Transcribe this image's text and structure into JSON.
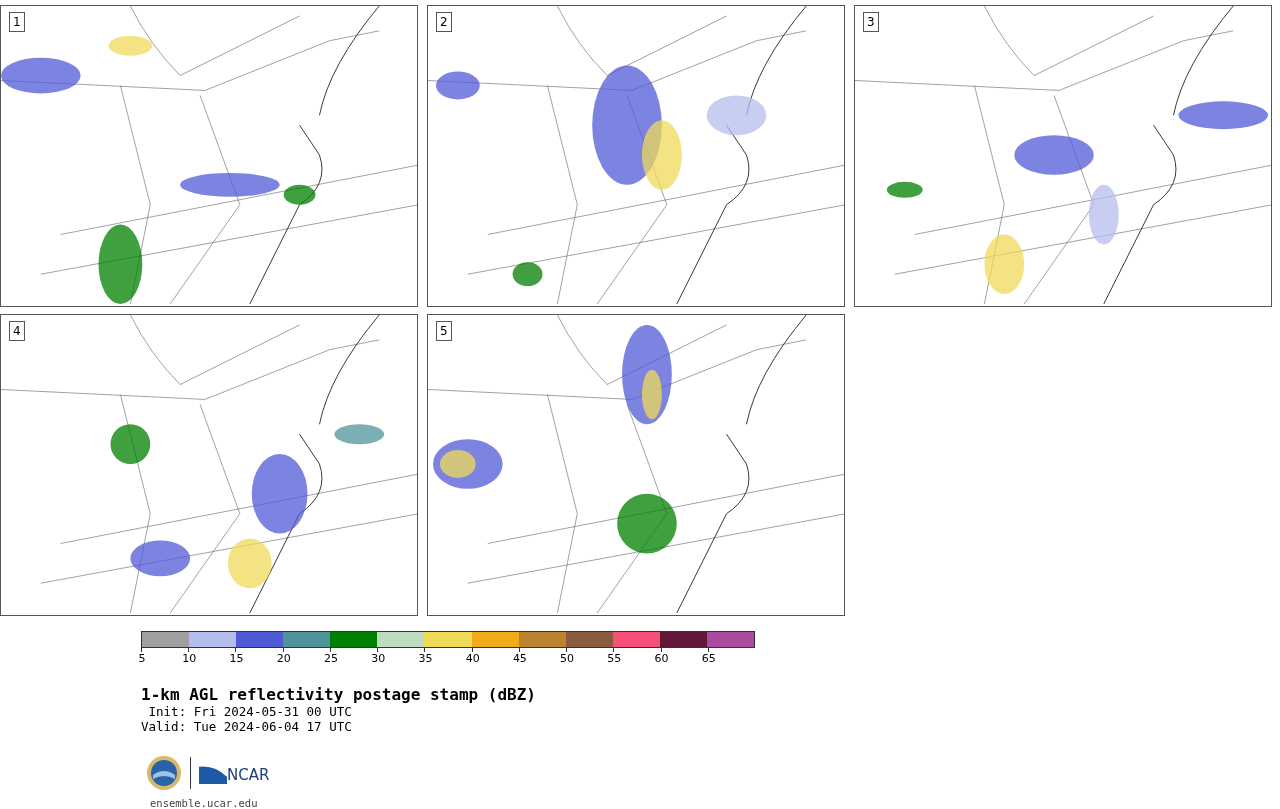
{
  "panels": [
    {
      "label": "1"
    },
    {
      "label": "2"
    },
    {
      "label": "3"
    },
    {
      "label": "4"
    },
    {
      "label": "5"
    }
  ],
  "colorbar": {
    "segments": [
      {
        "color": "#a0a0a0"
      },
      {
        "color": "#b4bdec"
      },
      {
        "color": "#5059d6"
      },
      {
        "color": "#4f949a"
      },
      {
        "color": "#008000"
      },
      {
        "color": "#bddcbd"
      },
      {
        "color": "#efda5a"
      },
      {
        "color": "#efac18"
      },
      {
        "color": "#bb8230"
      },
      {
        "color": "#8a5c3e"
      },
      {
        "color": "#f6507a"
      },
      {
        "color": "#641837"
      },
      {
        "color": "#ab4aa0"
      }
    ],
    "ticks": [
      "5",
      "10",
      "15",
      "20",
      "25",
      "30",
      "35",
      "40",
      "45",
      "50",
      "55",
      "60",
      "65"
    ]
  },
  "title": "1-km AGL reflectivity postage stamp (dBZ)",
  "init": " Init: Fri 2024-05-31 00 UTC",
  "valid": "Valid: Tue 2024-06-04 17 UTC",
  "logo_text": "NCAR",
  "footer_url": "ensemble.ucar.edu"
}
